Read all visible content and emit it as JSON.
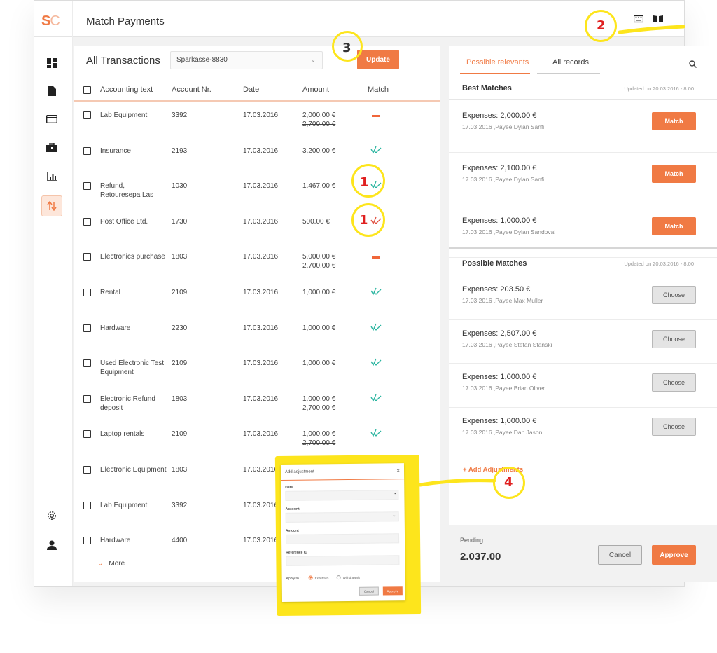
{
  "app": {
    "logo_s": "S",
    "logo_c": "C",
    "title": "Match Payments"
  },
  "colors": {
    "accent": "#f07a44",
    "highlight": "#fde51c",
    "annotation_red": "#e02020",
    "match_green": "#2bb5a0"
  },
  "top_icons": [
    "keyboard-icon",
    "book-icon"
  ],
  "sidebar": [
    "dashboard-icon",
    "document-icon",
    "credit-card-icon",
    "briefcase-icon",
    "bar-chart-icon",
    "transfer-icon",
    "settings-icon",
    "user-icon"
  ],
  "transactions": {
    "title": "All Transactions",
    "account": "Sparkasse-8830",
    "update_label": "Update",
    "columns": [
      "Accounting text",
      "Account Nr.",
      "Date",
      "Amount",
      "Match"
    ],
    "rows": [
      {
        "text": "Lab Equipment",
        "text2": "",
        "acct": "3392",
        "date": "17.03.2016",
        "amount": "2,000.00 €",
        "amount2": "2,700.00 €",
        "match": "dash"
      },
      {
        "text": "Insurance",
        "text2": "",
        "acct": "2193",
        "date": "17.03.2016",
        "amount": "3,200.00 €",
        "amount2": "",
        "match": "check"
      },
      {
        "text": "Refund,",
        "text2": "Retouresepa Las",
        "acct": "1030",
        "date": "17.03.2016",
        "amount": "1,467.00 €",
        "amount2": "",
        "match": "check"
      },
      {
        "text": "Post Office Ltd.",
        "text2": "",
        "acct": "1730",
        "date": "17.03.2016",
        "amount": "500.00 €",
        "amount2": "",
        "match": "manual"
      },
      {
        "text": "Electronics purchase",
        "text2": "",
        "acct": "1803",
        "date": "17.03.2016",
        "amount": "5,000.00 €",
        "amount2": "2,700.00 €",
        "match": "dash"
      },
      {
        "text": "Rental",
        "text2": "",
        "acct": "2109",
        "date": "17.03.2016",
        "amount": "1,000.00 €",
        "amount2": "",
        "match": "check"
      },
      {
        "text": "Hardware",
        "text2": "",
        "acct": "2230",
        "date": "17.03.2016",
        "amount": "1,000.00 €",
        "amount2": "",
        "match": "check"
      },
      {
        "text": "Used Electronic Test",
        "text2": "Equipment",
        "acct": "2109",
        "date": "17.03.2016",
        "amount": "1,000.00 €",
        "amount2": "",
        "match": "check"
      },
      {
        "text": "Electronic Refund",
        "text2": "deposit",
        "acct": "1803",
        "date": "17.03.2016",
        "amount": "1,000.00 €",
        "amount2": "2,700.00 €",
        "match": "check"
      },
      {
        "text": "Laptop rentals",
        "text2": "",
        "acct": "2109",
        "date": "17.03.2016",
        "amount": "1,000.00 €",
        "amount2": "2,700.00 €",
        "match": "check"
      },
      {
        "text": "Electronic Equipment",
        "text2": "",
        "acct": "1803",
        "date": "17.03.2016",
        "amount": "",
        "amount2": "",
        "match": "none"
      },
      {
        "text": "Lab Equipment",
        "text2": "",
        "acct": "3392",
        "date": "17.03.2016",
        "amount": "",
        "amount2": "",
        "match": "none"
      },
      {
        "text": "Hardware",
        "text2": "",
        "acct": "4400",
        "date": "17.03.2016",
        "amount": "",
        "amount2": "",
        "match": "none"
      }
    ],
    "more_label": "More"
  },
  "right": {
    "tab_active": "Possible relevants",
    "tab_other": "All records",
    "best": {
      "heading": "Best Matches",
      "updated": "Updated on 20.03.2016 - 8:00",
      "items": [
        {
          "title": "Expenses: 2,000.00 €",
          "sub": "17.03.2016 ,Payee Dylan Sanfi",
          "btn": "Match"
        },
        {
          "title": "Expenses: 2,100.00 €",
          "sub": "17.03.2016 ,Payee Dylan Sanfi",
          "btn": "Match"
        },
        {
          "title": "Expenses: 1,000.00 €",
          "sub": "17.03.2016 ,Payee Dylan Sandoval",
          "btn": "Match"
        }
      ]
    },
    "possible": {
      "heading": "Possible Matches",
      "updated": "Updated on 20.03.2016 - 8:00",
      "items": [
        {
          "title": "Expenses: 203.50 €",
          "sub": "17.03.2016 ,Payee Max Muller",
          "btn": "Choose"
        },
        {
          "title": "Expenses: 2,507.00 €",
          "sub": "17.03.2016 ,Payee Stefan Stanski",
          "btn": "Choose"
        },
        {
          "title": "Expenses: 1,000.00 €",
          "sub": "17.03.2016 ,Payee Brian Oliver",
          "btn": "Choose"
        },
        {
          "title": "Expenses: 1,000.00 €",
          "sub": "17.03.2016 ,Payee Dan Jason",
          "btn": "Choose"
        }
      ]
    },
    "add_adjustments": "+ Add Adjustments",
    "pending_label": "Pending:",
    "pending_value": "2.037.00",
    "cancel": "Cancel",
    "approve": "Approve"
  },
  "modal": {
    "title": "Add adjustment",
    "close": "×",
    "date": "Date",
    "account": "Account",
    "amount": "Amount",
    "reference": "Reference ID",
    "apply_to": "Apply to :",
    "opt1": "Expenses",
    "opt2": "Withdrawals",
    "cancel": "Cancel",
    "approve": "Approve"
  },
  "annotations": {
    "n1": "1",
    "n2": "2",
    "n3": "3",
    "n4": "4",
    "manual_mark": "M"
  }
}
